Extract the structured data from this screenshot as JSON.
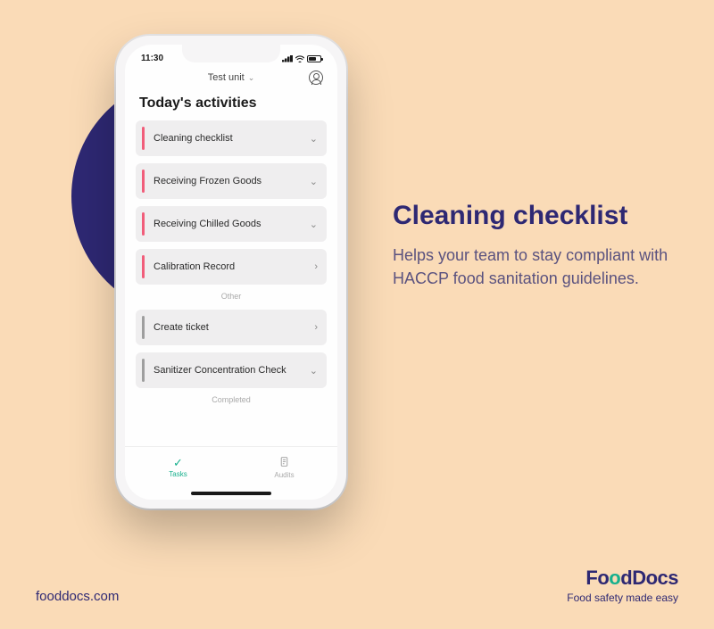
{
  "status": {
    "time": "11:30"
  },
  "header": {
    "unit": "Test unit"
  },
  "page": {
    "title": "Today's activities"
  },
  "sections": {
    "main": [
      {
        "label": "Cleaning checklist",
        "accent": "pink",
        "chevron": "down"
      },
      {
        "label": "Receiving Frozen Goods",
        "accent": "pink",
        "chevron": "down"
      },
      {
        "label": "Receiving Chilled Goods",
        "accent": "pink",
        "chevron": "down"
      },
      {
        "label": "Calibration Record",
        "accent": "pink",
        "chevron": "right"
      }
    ],
    "other_label": "Other",
    "other": [
      {
        "label": "Create ticket",
        "accent": "gray",
        "chevron": "right"
      },
      {
        "label": "Sanitizer Concentration Check",
        "accent": "gray",
        "chevron": "down"
      }
    ],
    "completed_label": "Completed"
  },
  "nav": {
    "tasks": "Tasks",
    "audits": "Audits"
  },
  "marketing": {
    "title": "Cleaning checklist",
    "body": "Helps your team to stay compliant with HACCP food sanitation guidelines."
  },
  "footer": {
    "url": "fooddocs.com",
    "brand": "FoodDocs",
    "tagline": "Food safety made easy"
  }
}
